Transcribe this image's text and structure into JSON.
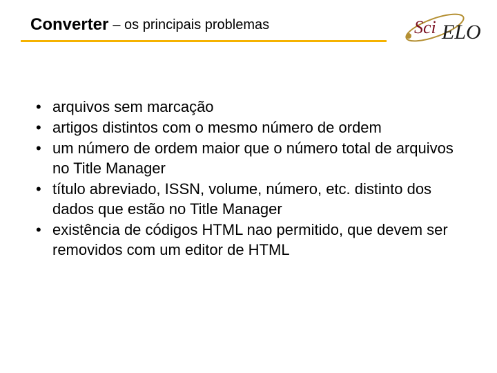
{
  "header": {
    "title_bold": "Converter",
    "title_rest": " – os principais problemas"
  },
  "logo": {
    "text_sci": "Sci",
    "text_elo": "ELO"
  },
  "bullets": [
    "arquivos sem marcação",
    "artigos distintos com o mesmo número de ordem",
    "um número de ordem maior que o número total de arquivos no Title Manager",
    "título abreviado, ISSN, volume, número, etc. distinto dos dados que estão no Title Manager",
    "existência de códigos HTML nao permitido, que devem ser removidos com um editor de HTML"
  ]
}
